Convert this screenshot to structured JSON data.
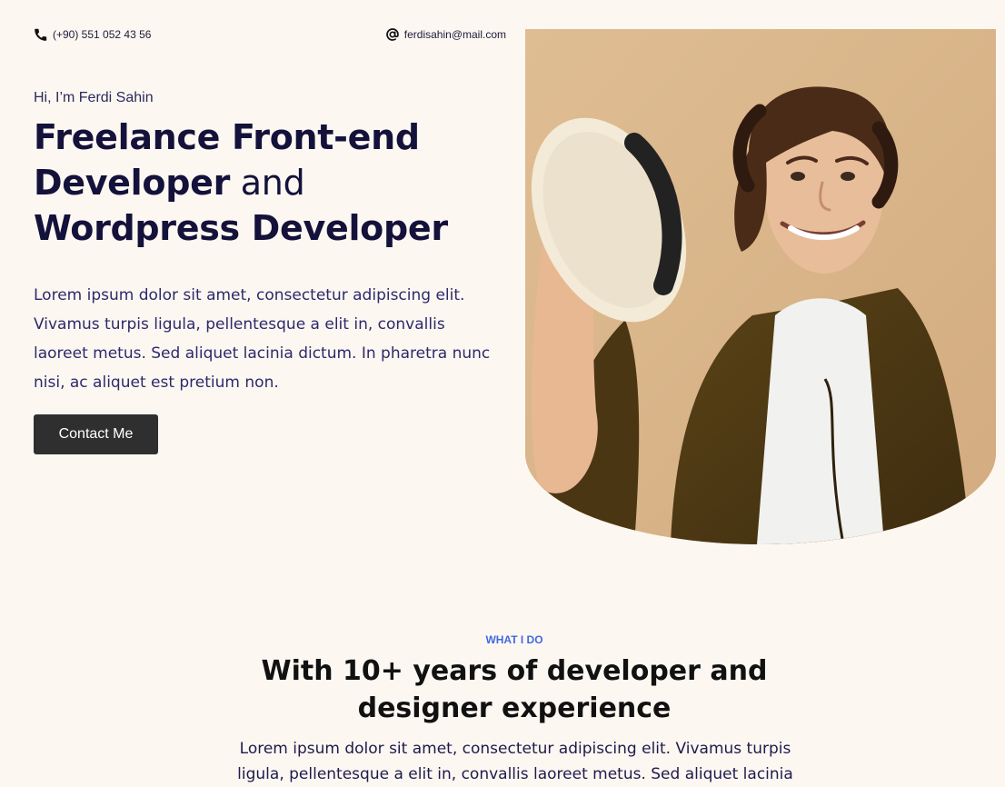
{
  "contact": {
    "phone": "(+90) 551 052 43 56",
    "email": "ferdisahin@mail.com",
    "phone_icon": "phone-icon",
    "email_icon": "at-sign-icon"
  },
  "hero": {
    "greeting": "Hi, I’m Ferdi Sahin",
    "headline": {
      "line1": "Freelance Front-end",
      "line2_strong": "Developer",
      "line2_light": " and",
      "line3": "Wordpress Developer"
    },
    "description": "Lorem ipsum dolor sit amet, consectetur adipiscing elit. Vivamus turpis ligula, pellentesque a elit in, convallis laoreet metus. Sed aliquet lacinia dictum. In pharetra nunc nisi, ac aliquet est pretium non.",
    "contact_button": "Contact Me"
  },
  "what_i_do": {
    "label": "WHAT I DO",
    "title": "With 10+ years of developer and designer experience",
    "text": "Lorem ipsum dolor sit amet, consectetur adipiscing elit. Vivamus turpis ligula, pellentesque a elit in, convallis laoreet metus. Sed aliquet lacinia"
  },
  "colors": {
    "background": "#fdf7f2",
    "heading": "#14123a",
    "accent": "#4169e1",
    "button": "#2f2f2f"
  }
}
